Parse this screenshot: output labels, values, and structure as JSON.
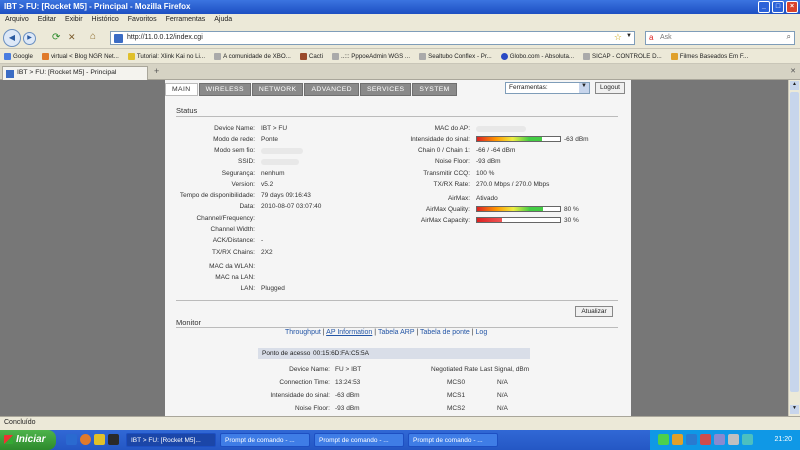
{
  "window": {
    "title": "IBT > FU: [Rocket M5] - Principal - Mozilla Firefox"
  },
  "menu": [
    "Arquivo",
    "Editar",
    "Exibir",
    "Histórico",
    "Favoritos",
    "Ferramentas",
    "Ajuda"
  ],
  "nav": {
    "url": "http://11.0.0.12/index.cgi",
    "search_placeholder": "Ask"
  },
  "bookmarks": [
    "Google",
    "virtual < Blog NGR Net...",
    "Tutorial: Xlink Kai no Li...",
    "A comunidade de XBO...",
    "Cacti",
    "..::: PppoeAdmin WGS ...",
    "Sealtubo Conflex - Pr...",
    "Globo.com - Absoluta...",
    "SICAP - CONTROLE D...",
    "Filmes Baseados Em F..."
  ],
  "browser_tab": {
    "label": "IBT > FU: [Rocket M5] - Principal",
    "new_tab": "+"
  },
  "ap_tabs": [
    "MAIN",
    "WIRELESS",
    "NETWORK",
    "ADVANCED",
    "SERVICES",
    "SYSTEM"
  ],
  "tools": {
    "selected": "Ferramentas:",
    "logout": "Logout"
  },
  "status": {
    "heading": "Status",
    "left": [
      {
        "label": "Device Name:",
        "value": "IBT > FU"
      },
      {
        "label": "Modo de rede:",
        "value": "Ponte"
      },
      {
        "label": "Modo sem fio:",
        "value": ""
      },
      {
        "label": "SSID:",
        "value": ""
      },
      {
        "label": "Segurança:",
        "value": "nenhum"
      },
      {
        "label": "Version:",
        "value": "v5.2"
      },
      {
        "label": "Tempo de disponibilidade:",
        "value": "79 days 09:16:43"
      },
      {
        "label": "Data:",
        "value": "2010-08-07 03:07:40"
      },
      {
        "label": "Channel/Frequency:",
        "value": ""
      },
      {
        "label": "Channel Width:",
        "value": ""
      },
      {
        "label": "ACK/Distance:",
        "value": "-"
      },
      {
        "label": "TX/RX Chains:",
        "value": "2X2"
      },
      {
        "label": "MAC da WLAN:",
        "value": ""
      },
      {
        "label": "MAC na LAN:",
        "value": ""
      },
      {
        "label": "LAN:",
        "value": "Plugged"
      }
    ],
    "right": [
      {
        "label": "MAC do AP:",
        "value": ""
      },
      {
        "label": "Intensidade do sinal:",
        "value": "-63 dBm"
      },
      {
        "label": "Chain 0 / Chain 1:",
        "value": "-66 / -64 dBm"
      },
      {
        "label": "Noise Floor:",
        "value": "-93 dBm"
      },
      {
        "label": "Transmitir CCQ:",
        "value": "100 %"
      },
      {
        "label": "TX/RX Rate:",
        "value": "270.0 Mbps / 270.0 Mbps"
      },
      {
        "label": "AirMax:",
        "value": "Ativado"
      },
      {
        "label": "AirMax Quality:",
        "value": "80 %"
      },
      {
        "label": "AirMax Capacity:",
        "value": "30 %"
      }
    ],
    "signal_level": 0.78,
    "quality_level": 0.8,
    "capacity_level": 0.3,
    "refresh": "Atualizar"
  },
  "monitor": {
    "heading": "Monitor",
    "links": [
      "Throughput",
      "AP Information",
      "Tabela ARP",
      "Tabela de ponte",
      "Log"
    ],
    "ap_label": "Ponto de acesso",
    "ap_mac": "00:15:6D:FA:C5:5A",
    "info": [
      {
        "label": "Device Name:",
        "value": "FU > IBT"
      },
      {
        "label": "Connection Time:",
        "value": "13:24:53"
      },
      {
        "label": "Intensidade do sinal:",
        "value": "-63 dBm"
      },
      {
        "label": "Noise Floor:",
        "value": "-93 dBm"
      }
    ],
    "rate_headers": [
      "Negotiated Rate",
      "Last Signal, dBm"
    ],
    "rates": [
      {
        "mcs": "MCS0",
        "signal": "N/A"
      },
      {
        "mcs": "MCS1",
        "signal": "N/A"
      },
      {
        "mcs": "MCS2",
        "signal": "N/A"
      }
    ]
  },
  "statusbar": "Concluído",
  "taskbar": {
    "start": "Iniciar",
    "buttons": [
      "IBT > FU: [Rocket M5]...",
      "Prompt de comando - ...",
      "Prompt de comando - ...",
      "Prompt de comando - ..."
    ],
    "clock": "21:20"
  }
}
